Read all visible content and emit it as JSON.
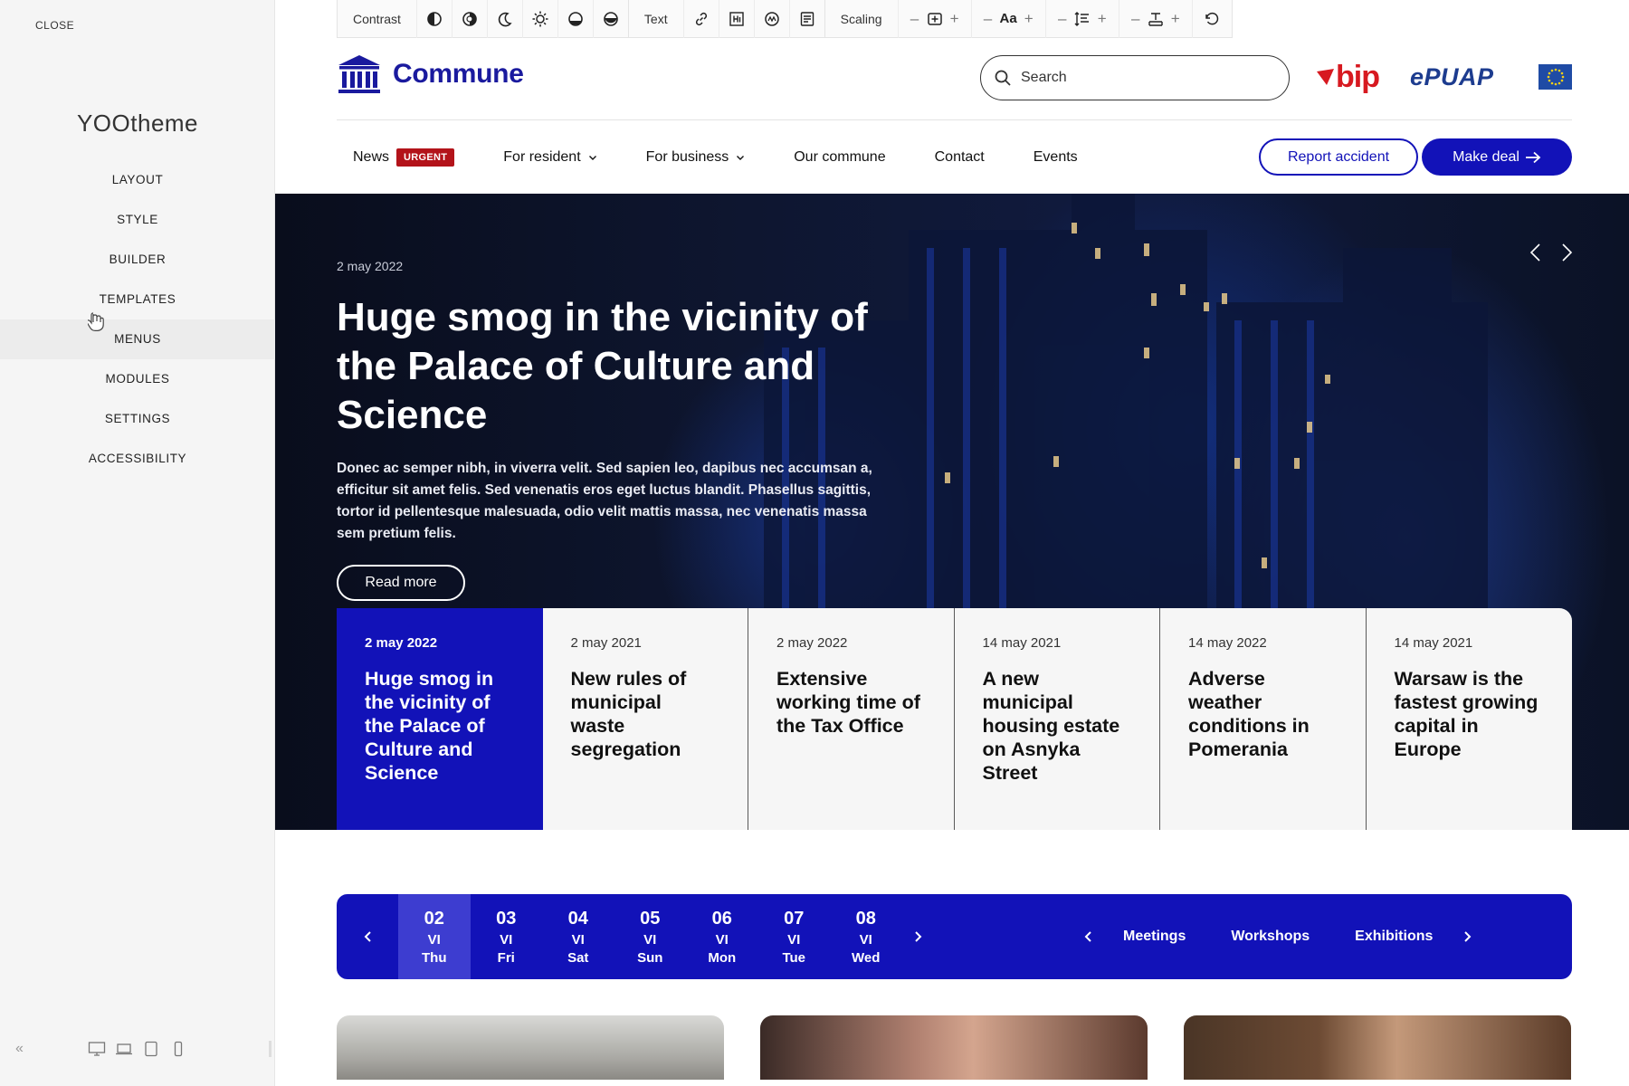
{
  "customizer": {
    "close_label": "CLOSE",
    "brand": "YOOtheme",
    "nav": [
      {
        "label": "LAYOUT"
      },
      {
        "label": "STYLE"
      },
      {
        "label": "BUILDER"
      },
      {
        "label": "TEMPLATES"
      },
      {
        "label": "MENUS"
      },
      {
        "label": "MODULES"
      },
      {
        "label": "SETTINGS"
      },
      {
        "label": "ACCESSIBILITY"
      }
    ],
    "hovered_item": "MENUS",
    "devices": [
      "desktop-icon",
      "laptop-icon",
      "tablet-icon",
      "phone-icon"
    ]
  },
  "toolbar": {
    "contrast_label": "Contrast",
    "text_label": "Text",
    "scaling_label": "Scaling",
    "font_size_label": "Aa"
  },
  "header": {
    "logo_text": "Commune",
    "search_placeholder": "Search",
    "bip_text": "bip",
    "epuap_text": "ePUAP"
  },
  "nav": {
    "items": [
      {
        "label": "News",
        "badge": "URGENT"
      },
      {
        "label": "For resident",
        "dropdown": true
      },
      {
        "label": "For business",
        "dropdown": true
      },
      {
        "label": "Our commune"
      },
      {
        "label": "Contact"
      },
      {
        "label": "Events"
      }
    ],
    "report_label": "Report accident",
    "deal_label": "Make deal"
  },
  "hero": {
    "date": "2 may 2022",
    "title": "Huge smog in the vicinity of the Palace of Culture and Science",
    "text": "Donec ac semper nibh, in viverra velit. Sed sapien leo, dapibus nec accumsan a, efficitur sit amet felis. Sed venenatis eros eget luctus blandit. Phasellus sagittis, tortor id pellentesque malesuada, odio velit mattis massa, nec venenatis massa sem pretium felis.",
    "read_more": "Read more"
  },
  "news_cards": [
    {
      "date": "2 may 2022",
      "title": "Huge smog in the vicinity of the Palace of Culture and Science",
      "active": true
    },
    {
      "date": "2 may 2021",
      "title": "New rules of municipal waste segregation"
    },
    {
      "date": "2 may 2022",
      "title": "Extensive working time of the Tax Office"
    },
    {
      "date": "14 may 2021",
      "title": "A new municipal housing estate on Asnyka Street"
    },
    {
      "date": "14 may 2022",
      "title": "Adverse weather conditions in Pomerania"
    },
    {
      "date": "14 may 2021",
      "title": "Warsaw is the fastest growing capital in Europe"
    }
  ],
  "calendar": {
    "days": [
      {
        "num": "02",
        "month": "VI",
        "weekday": "Thu",
        "selected": true
      },
      {
        "num": "03",
        "month": "VI",
        "weekday": "Fri"
      },
      {
        "num": "04",
        "month": "VI",
        "weekday": "Sat"
      },
      {
        "num": "05",
        "month": "VI",
        "weekday": "Sun"
      },
      {
        "num": "06",
        "month": "VI",
        "weekday": "Mon"
      },
      {
        "num": "07",
        "month": "VI",
        "weekday": "Tue"
      },
      {
        "num": "08",
        "month": "VI",
        "weekday": "Wed"
      }
    ],
    "categories": [
      "Meetings",
      "Workshops",
      "Exhibitions"
    ]
  },
  "colors": {
    "primary": "#1212b8",
    "urgent": "#b3131a",
    "bip_red": "#d71920",
    "epuap_blue": "#1d3c8f"
  }
}
